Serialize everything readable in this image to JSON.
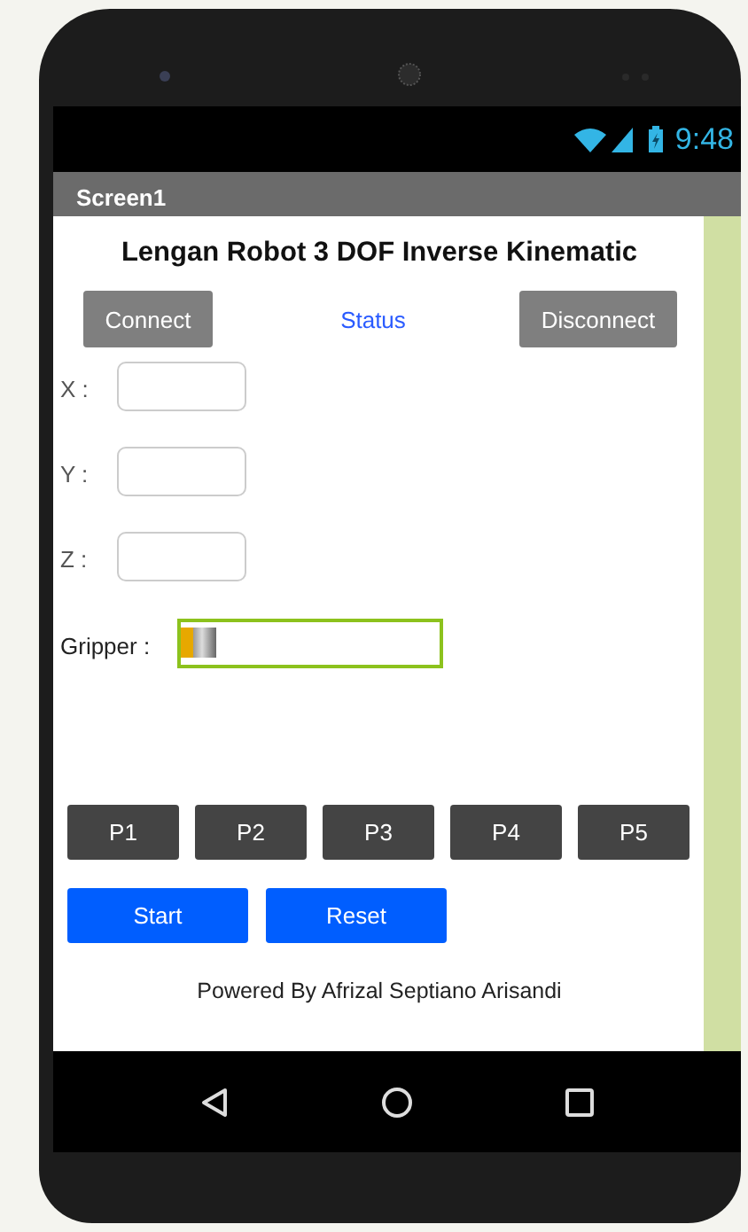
{
  "status_bar": {
    "time": "9:48"
  },
  "title_bar": {
    "title": "Screen1"
  },
  "heading": "Lengan Robot 3 DOF Inverse Kinematic",
  "connect_row": {
    "connect": "Connect",
    "status": "Status",
    "disconnect": "Disconnect"
  },
  "coordinates": [
    {
      "label": "X :"
    },
    {
      "label": "Y :"
    },
    {
      "label": "Z :"
    }
  ],
  "gripper": {
    "label": "Gripper :",
    "level": 0
  },
  "position_buttons": [
    "P1",
    "P2",
    "P3",
    "P4",
    "P5"
  ],
  "actions": [
    "Start",
    "Reset"
  ],
  "footer": "Powered By Afrizal Septiano Arisandi"
}
